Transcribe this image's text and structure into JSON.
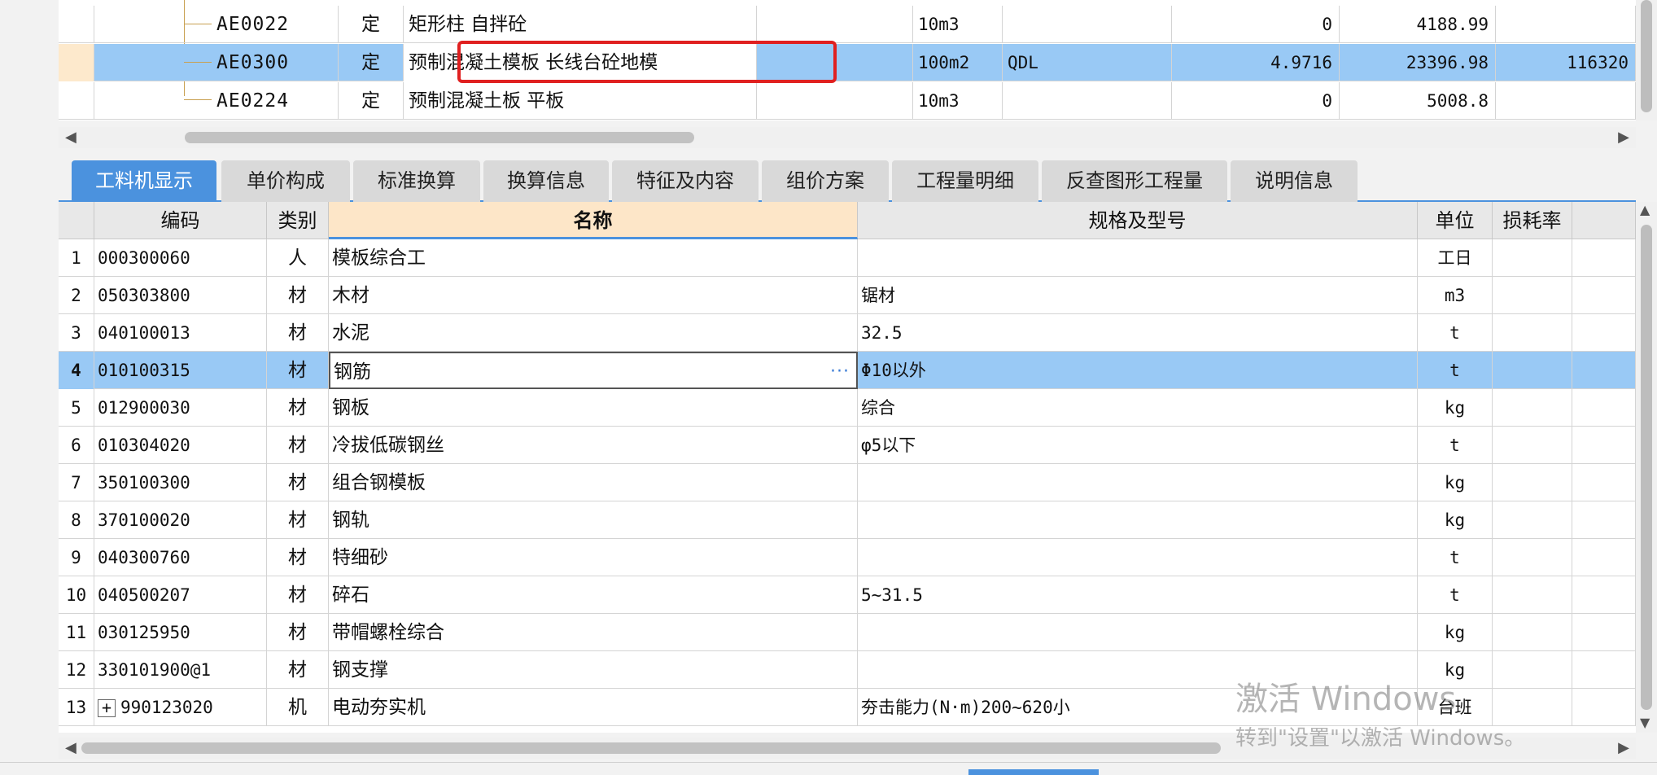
{
  "upper_grid": {
    "rows": [
      {
        "code": "AE0022",
        "type": "定",
        "name": "矩形柱 自拌砼",
        "unit": "10m3",
        "expr": "",
        "qty": "0",
        "price": "4188.99",
        "total": ""
      },
      {
        "code": "AE0300",
        "type": "定",
        "name": "预制混凝土模板 长线台砼地模",
        "unit": "100m2",
        "expr": "QDL",
        "qty": "4.9716",
        "price": "23396.98",
        "total": "116320"
      },
      {
        "code": "AE0224",
        "type": "定",
        "name": "预制混凝土板 平板",
        "unit": "10m3",
        "expr": "",
        "qty": "0",
        "price": "5008.8",
        "total": ""
      }
    ]
  },
  "tabs": [
    "工料机显示",
    "单价构成",
    "标准换算",
    "换算信息",
    "特征及内容",
    "组价方案",
    "工程量明细",
    "反查图形工程量",
    "说明信息"
  ],
  "active_tab": "工料机显示",
  "lower_grid": {
    "headers": {
      "code": "编码",
      "category": "类别",
      "name": "名称",
      "spec": "规格及型号",
      "unit": "单位",
      "loss": "损耗率"
    },
    "rows": [
      {
        "no": "1",
        "code": "000300060",
        "category": "人",
        "name": "模板综合工",
        "spec": "",
        "unit": "工日"
      },
      {
        "no": "2",
        "code": "050303800",
        "category": "材",
        "name": "木材",
        "spec": "锯材",
        "unit": "m3"
      },
      {
        "no": "3",
        "code": "040100013",
        "category": "材",
        "name": "水泥",
        "spec": "32.5",
        "unit": "t"
      },
      {
        "no": "4",
        "code": "010100315",
        "category": "材",
        "name": "钢筋",
        "spec": "Φ10以外",
        "unit": "t"
      },
      {
        "no": "5",
        "code": "012900030",
        "category": "材",
        "name": "钢板",
        "spec": "综合",
        "unit": "kg"
      },
      {
        "no": "6",
        "code": "010304020",
        "category": "材",
        "name": "冷拔低碳钢丝",
        "spec": "φ5以下",
        "unit": "t"
      },
      {
        "no": "7",
        "code": "350100300",
        "category": "材",
        "name": "组合钢模板",
        "spec": "",
        "unit": "kg"
      },
      {
        "no": "8",
        "code": "370100020",
        "category": "材",
        "name": "钢轨",
        "spec": "",
        "unit": "kg"
      },
      {
        "no": "9",
        "code": "040300760",
        "category": "材",
        "name": "特细砂",
        "spec": "",
        "unit": "t"
      },
      {
        "no": "10",
        "code": "040500207",
        "category": "材",
        "name": "碎石",
        "spec": "5~31.5",
        "unit": "t"
      },
      {
        "no": "11",
        "code": "030125950",
        "category": "材",
        "name": "带帽螺栓综合",
        "spec": "",
        "unit": "kg"
      },
      {
        "no": "12",
        "code": "330101900@1",
        "category": "材",
        "name": "钢支撑",
        "spec": "",
        "unit": "kg"
      },
      {
        "no": "13",
        "code": "990123020",
        "category": "机",
        "name": "电动夯实机",
        "spec": "夯击能力(N·m)200~620小",
        "unit": "台班"
      }
    ],
    "edit_dots": "···",
    "expander": "+"
  },
  "watermark": {
    "line1": "激活 Windows",
    "line2": "转到\"设置\"以激活 Windows。"
  },
  "colors": {
    "selection": "#99c9f5",
    "tab_active": "#4b92de",
    "header_active": "#fde6c8",
    "highlight_box": "#e02020"
  }
}
